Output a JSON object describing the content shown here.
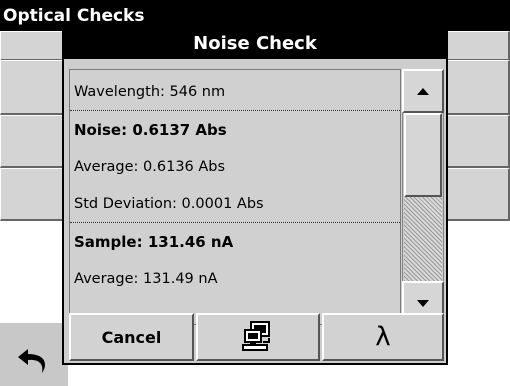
{
  "background": {
    "title": "Optical Checks"
  },
  "dialog": {
    "title": "Noise Check",
    "rows": [
      {
        "text": "Wavelength: 546 nm"
      },
      {
        "text": "Noise: 0.6137 Abs"
      },
      {
        "text": "Average: 0.6136 Abs"
      },
      {
        "text": "Std Deviation: 0.0001 Abs"
      },
      {
        "text": "Sample: 131.46 nA"
      },
      {
        "text": "Average: 131.49 nA"
      }
    ],
    "buttons": {
      "cancel": "Cancel",
      "lambda": "λ"
    }
  },
  "icons": {
    "back": "back-arrow-icon",
    "computer": "computer-icon",
    "scroll_up": "scroll-up-icon",
    "scroll_down": "scroll-down-icon"
  }
}
